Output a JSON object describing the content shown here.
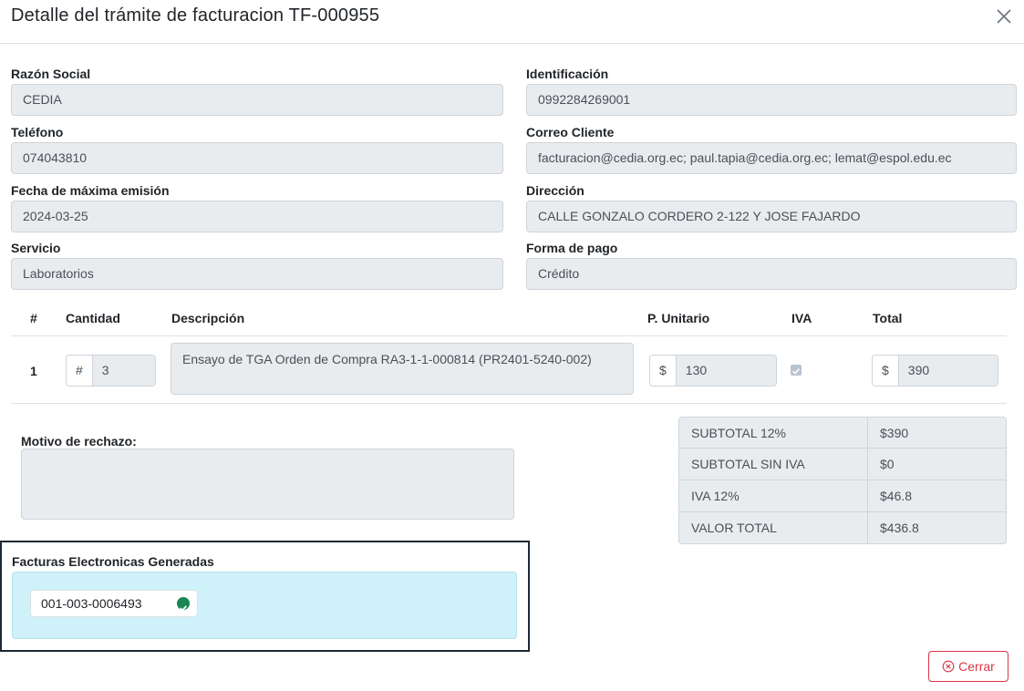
{
  "modal": {
    "title": "Detalle del trámite de facturacion TF-000955"
  },
  "fields": {
    "razon_social": {
      "label": "Razón Social",
      "value": "CEDIA"
    },
    "identificacion": {
      "label": "Identificación",
      "value": "0992284269001"
    },
    "telefono": {
      "label": "Teléfono",
      "value": "074043810"
    },
    "correo": {
      "label": "Correo Cliente",
      "value": "facturacion@cedia.org.ec; paul.tapia@cedia.org.ec; lemat@espol.edu.ec"
    },
    "fecha": {
      "label": "Fecha de máxima emisión",
      "value": "2024-03-25"
    },
    "direccion": {
      "label": "Dirección",
      "value": "CALLE GONZALO CORDERO 2-122 Y JOSE FAJARDO"
    },
    "servicio": {
      "label": "Servicio",
      "value": "Laboratorios"
    },
    "forma_pago": {
      "label": "Forma de pago",
      "value": "Crédito"
    }
  },
  "table": {
    "headers": {
      "num": "#",
      "cantidad": "Cantidad",
      "descripcion": "Descripción",
      "unitario": "P. Unitario",
      "iva": "IVA",
      "total": "Total"
    },
    "rows": [
      {
        "num": "1",
        "cantidad_prefix": "#",
        "cantidad": "3",
        "descripcion": "Ensayo de TGA Orden de Compra RA3-1-1-000814 (PR2401-5240-002)",
        "unitario_prefix": "$",
        "unitario": "130",
        "iva_checked": true,
        "total_prefix": "$",
        "total": "390"
      }
    ]
  },
  "totals": [
    {
      "label": "SUBTOTAL 12%",
      "value": "$390"
    },
    {
      "label": "SUBTOTAL SIN IVA",
      "value": "$0"
    },
    {
      "label": "IVA 12%",
      "value": "$46.8"
    },
    {
      "label": "VALOR TOTAL",
      "value": "$436.8"
    }
  ],
  "rechazo": {
    "label": "Motivo de rechazo:",
    "value": ""
  },
  "facturas": {
    "label": "Facturas Electronicas Generadas",
    "items": [
      {
        "number": "001-003-0006493",
        "status_icon": "check-circle-icon",
        "status_color": "#198754"
      }
    ]
  },
  "footer": {
    "close_label": "Cerrar",
    "close_icon": "x-circle-icon",
    "close_color": "#dc3545"
  }
}
